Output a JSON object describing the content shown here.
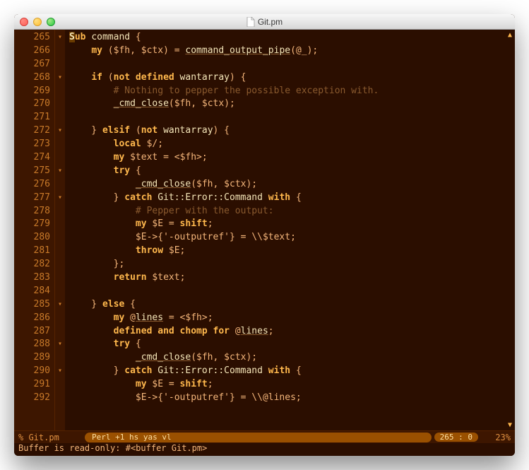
{
  "window": {
    "title": "Git.pm"
  },
  "gutter": {
    "start": 265,
    "end": 292
  },
  "folds": [
    "▾",
    "",
    "",
    "▾",
    "",
    "",
    "",
    "▾",
    "",
    "",
    "▾",
    "",
    "▾",
    "",
    "",
    "",
    "",
    "",
    "",
    "",
    "▾",
    "",
    "",
    "▾",
    "",
    "▾",
    "",
    ""
  ],
  "code": [
    [
      [
        "sub",
        "S",
        "cursor"
      ],
      [
        "kw",
        "ub "
      ],
      [
        "ident",
        "command"
      ],
      [
        "punct",
        " {"
      ]
    ],
    [
      [
        "plain",
        "    "
      ],
      [
        "kw",
        "my "
      ],
      [
        "punct",
        "("
      ],
      [
        "var",
        "$fh"
      ],
      [
        "punct",
        ", "
      ],
      [
        "var",
        "$ctx"
      ],
      [
        "punct",
        ") = "
      ],
      [
        "func",
        "command_output_pipe"
      ],
      [
        "punct",
        "("
      ],
      [
        "var",
        "@_"
      ],
      [
        "punct",
        ");"
      ]
    ],
    [
      [
        "plain",
        ""
      ]
    ],
    [
      [
        "plain",
        "    "
      ],
      [
        "kw",
        "if "
      ],
      [
        "punct",
        "("
      ],
      [
        "kw",
        "not defined "
      ],
      [
        "ident",
        "wantarray"
      ],
      [
        "punct",
        ") {"
      ]
    ],
    [
      [
        "plain",
        "        "
      ],
      [
        "comment",
        "# Nothing to pepper the possible exception with."
      ]
    ],
    [
      [
        "plain",
        "        "
      ],
      [
        "func",
        "_cmd_close"
      ],
      [
        "punct",
        "("
      ],
      [
        "var",
        "$fh"
      ],
      [
        "punct",
        ", "
      ],
      [
        "var",
        "$ctx"
      ],
      [
        "punct",
        ");"
      ]
    ],
    [
      [
        "plain",
        ""
      ]
    ],
    [
      [
        "plain",
        "    } "
      ],
      [
        "kw",
        "elsif "
      ],
      [
        "punct",
        "("
      ],
      [
        "kw",
        "not "
      ],
      [
        "ident",
        "wantarray"
      ],
      [
        "punct",
        ") {"
      ]
    ],
    [
      [
        "plain",
        "        "
      ],
      [
        "kw",
        "local "
      ],
      [
        "var",
        "$/"
      ],
      [
        "punct",
        ";"
      ]
    ],
    [
      [
        "plain",
        "        "
      ],
      [
        "kw",
        "my "
      ],
      [
        "var",
        "$text"
      ],
      [
        "punct",
        " = <"
      ],
      [
        "var",
        "$fh"
      ],
      [
        "punct",
        ">;"
      ]
    ],
    [
      [
        "plain",
        "        "
      ],
      [
        "kw",
        "try "
      ],
      [
        "punct",
        "{"
      ]
    ],
    [
      [
        "plain",
        "            "
      ],
      [
        "func",
        "_cmd_close"
      ],
      [
        "punct",
        "("
      ],
      [
        "var",
        "$fh"
      ],
      [
        "punct",
        ", "
      ],
      [
        "var",
        "$ctx"
      ],
      [
        "punct",
        ");"
      ]
    ],
    [
      [
        "plain",
        "        } "
      ],
      [
        "kw",
        "catch "
      ],
      [
        "ident",
        "Git::Error::Command "
      ],
      [
        "kw",
        "with "
      ],
      [
        "punct",
        "{"
      ]
    ],
    [
      [
        "plain",
        "            "
      ],
      [
        "comment",
        "# Pepper with the output:"
      ]
    ],
    [
      [
        "plain",
        "            "
      ],
      [
        "kw",
        "my "
      ],
      [
        "var",
        "$E"
      ],
      [
        "punct",
        " = "
      ],
      [
        "kw",
        "shift"
      ],
      [
        "punct",
        ";"
      ]
    ],
    [
      [
        "plain",
        "            "
      ],
      [
        "var",
        "$E"
      ],
      [
        "punct",
        "->{"
      ],
      [
        "string",
        "'-outputref'"
      ],
      [
        "punct",
        "} = \\\\"
      ],
      [
        "var",
        "$text"
      ],
      [
        "punct",
        ";"
      ]
    ],
    [
      [
        "plain",
        "            "
      ],
      [
        "kw",
        "throw "
      ],
      [
        "var",
        "$E"
      ],
      [
        "punct",
        ";"
      ]
    ],
    [
      [
        "plain",
        "        };"
      ]
    ],
    [
      [
        "plain",
        "        "
      ],
      [
        "kw",
        "return "
      ],
      [
        "var",
        "$text"
      ],
      [
        "punct",
        ";"
      ]
    ],
    [
      [
        "plain",
        ""
      ]
    ],
    [
      [
        "plain",
        "    } "
      ],
      [
        "kw",
        "else "
      ],
      [
        "punct",
        "{"
      ]
    ],
    [
      [
        "plain",
        "        "
      ],
      [
        "kw",
        "my "
      ],
      [
        "var",
        "@"
      ],
      [
        "func",
        "lines"
      ],
      [
        "punct",
        " = <"
      ],
      [
        "var",
        "$fh"
      ],
      [
        "punct",
        ">;"
      ]
    ],
    [
      [
        "plain",
        "        "
      ],
      [
        "kw",
        "defined and chomp for "
      ],
      [
        "var",
        "@"
      ],
      [
        "func",
        "lines"
      ],
      [
        "punct",
        ";"
      ]
    ],
    [
      [
        "plain",
        "        "
      ],
      [
        "kw",
        "try "
      ],
      [
        "punct",
        "{"
      ]
    ],
    [
      [
        "plain",
        "            "
      ],
      [
        "func",
        "_cmd_close"
      ],
      [
        "punct",
        "("
      ],
      [
        "var",
        "$fh"
      ],
      [
        "punct",
        ", "
      ],
      [
        "var",
        "$ctx"
      ],
      [
        "punct",
        ");"
      ]
    ],
    [
      [
        "plain",
        "        } "
      ],
      [
        "kw",
        "catch "
      ],
      [
        "ident",
        "Git::Error::Command "
      ],
      [
        "kw",
        "with "
      ],
      [
        "punct",
        "{"
      ]
    ],
    [
      [
        "plain",
        "            "
      ],
      [
        "kw",
        "my "
      ],
      [
        "var",
        "$E"
      ],
      [
        "punct",
        " = "
      ],
      [
        "kw",
        "shift"
      ],
      [
        "punct",
        ";"
      ]
    ],
    [
      [
        "plain",
        "            "
      ],
      [
        "var",
        "$E"
      ],
      [
        "punct",
        "->{"
      ],
      [
        "string",
        "'-outputref'"
      ],
      [
        "punct",
        "} = \\\\"
      ],
      [
        "var",
        "@lines"
      ],
      [
        "punct",
        ";"
      ]
    ]
  ],
  "modeline": {
    "file_indicator": "% Git.pm",
    "mode": "Perl +1 hs yas vl",
    "position": "265 :  0",
    "percent": "23%"
  },
  "minibuffer": "Buffer is read-only: #<buffer Git.pm>"
}
